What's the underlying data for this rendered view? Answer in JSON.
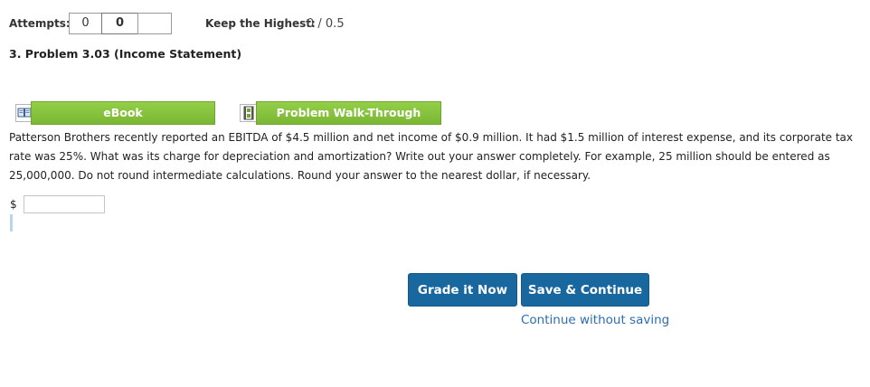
{
  "attempts": {
    "label": "Attempts:",
    "boxes": [
      "0",
      "0",
      ""
    ]
  },
  "keep_highest": {
    "label": "Keep the Highest:",
    "score": "0 / 0.5"
  },
  "problem": {
    "title": "3. Problem 3.03 (Income Statement)"
  },
  "resources": {
    "ebook_label": "eBook",
    "ebook_icon": "book-icon",
    "walkthrough_label": "Problem Walk-Through",
    "walkthrough_icon": "film-icon"
  },
  "question": {
    "text": "Patterson Brothers recently reported an EBITDA of $4.5 million and net income of $0.9 million. It had $1.5 million of interest expense, and its corporate tax rate was 25%. What was its charge for depreciation and amortization? Write out your answer completely. For example, 25 million should be entered as 25,000,000. Do not round intermediate calculations. Round your answer to the nearest dollar, if necessary."
  },
  "answer": {
    "currency": "$",
    "value": ""
  },
  "actions": {
    "grade_label": "Grade it Now",
    "save_label": "Save & Continue",
    "continue_label": "Continue without saving"
  },
  "colors": {
    "green_button": "#7ab734",
    "blue_button": "#19679f",
    "link": "#2a6eaf"
  }
}
